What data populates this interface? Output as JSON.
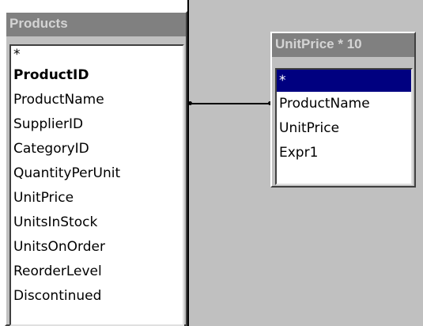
{
  "products_table": {
    "title": "Products",
    "fields": [
      {
        "label": "*",
        "key": false
      },
      {
        "label": "ProductID",
        "key": true
      },
      {
        "label": "ProductName",
        "key": false
      },
      {
        "label": "SupplierID",
        "key": false
      },
      {
        "label": "CategoryID",
        "key": false
      },
      {
        "label": "QuantityPerUnit",
        "key": false
      },
      {
        "label": "UnitPrice",
        "key": false
      },
      {
        "label": "UnitsInStock",
        "key": false
      },
      {
        "label": "UnitsOnOrder",
        "key": false
      },
      {
        "label": "ReorderLevel",
        "key": false
      },
      {
        "label": "Discontinued",
        "key": false
      }
    ]
  },
  "query_table": {
    "title": "UnitPrice * 10",
    "selected_field": "*",
    "fields": [
      {
        "label": "*"
      },
      {
        "label": "ProductName"
      },
      {
        "label": "UnitPrice"
      },
      {
        "label": "Expr1"
      }
    ]
  },
  "colors": {
    "title_bar_inactive": "#808080",
    "selection": "#000080",
    "background": "#c0c0c0"
  }
}
